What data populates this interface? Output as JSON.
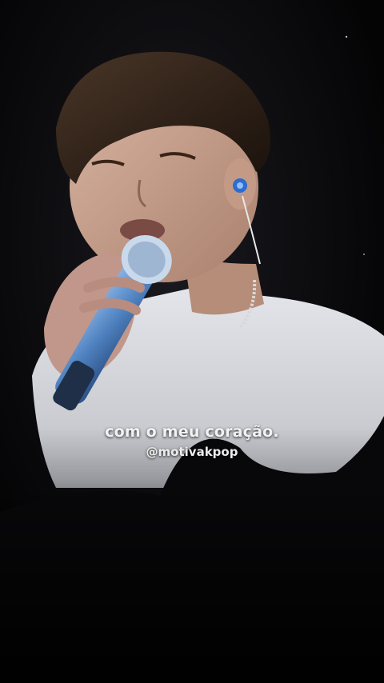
{
  "video": {
    "subtitle": "com o meu coração.",
    "watermark": "@motivakpop"
  },
  "colors": {
    "background": "#050507",
    "shirt": "#d9dbe0",
    "hair": "#3a2a1e",
    "skin": "#c69f8c",
    "mic": "#5d8fc9",
    "text": "#f2f2f2"
  }
}
